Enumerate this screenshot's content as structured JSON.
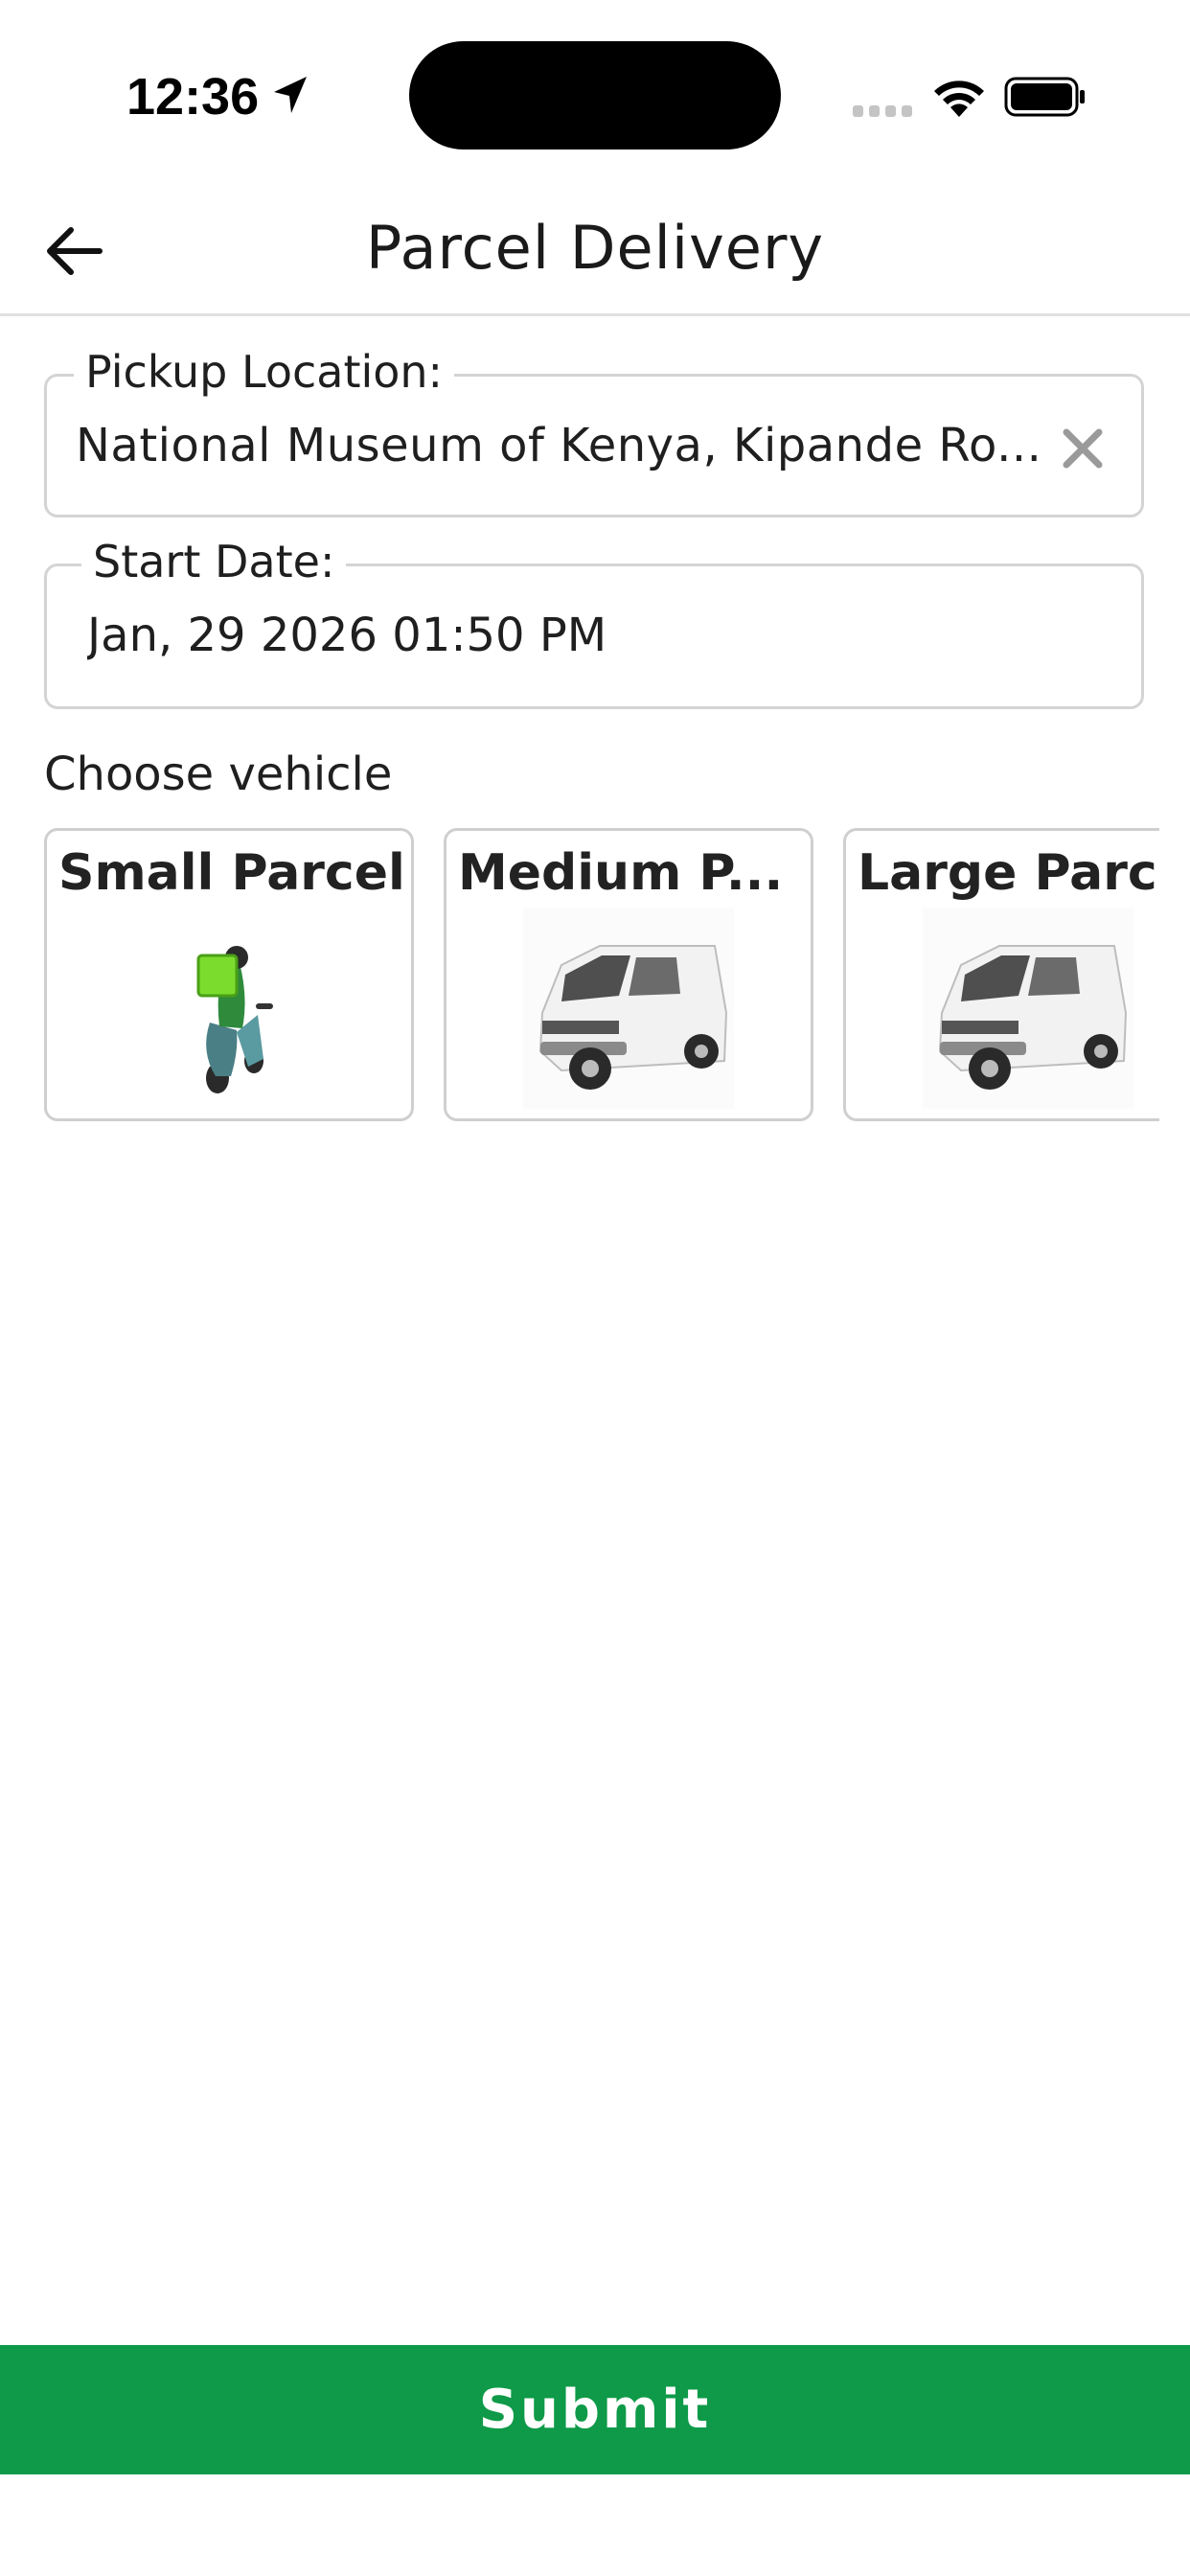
{
  "status_bar": {
    "time": "12:36",
    "icons": [
      "location-arrow-icon",
      "cellular-signal-icon",
      "wifi-icon",
      "battery-icon"
    ]
  },
  "header": {
    "title": "Parcel Delivery",
    "back_icon": "back-arrow-icon"
  },
  "form": {
    "pickup": {
      "label": "Pickup Location:",
      "value": "National Museum of Kenya, Kipande Ro...",
      "clear_icon": "close-icon"
    },
    "start_date": {
      "label": "Start Date:",
      "value": "Jan, 29 2026 01:50 PM"
    }
  },
  "vehicles": {
    "label": "Choose vehicle",
    "options": [
      {
        "name": "Small Parcel",
        "image": "scooter-courier-image"
      },
      {
        "name": "Medium P...",
        "image": "van-image"
      },
      {
        "name": "Large Parcel",
        "image": "van-image"
      }
    ]
  },
  "submit": {
    "label": "Submit"
  },
  "colors": {
    "accent": "#0e9a48",
    "border": "#d4d4d4",
    "text": "#1f1f1f"
  }
}
